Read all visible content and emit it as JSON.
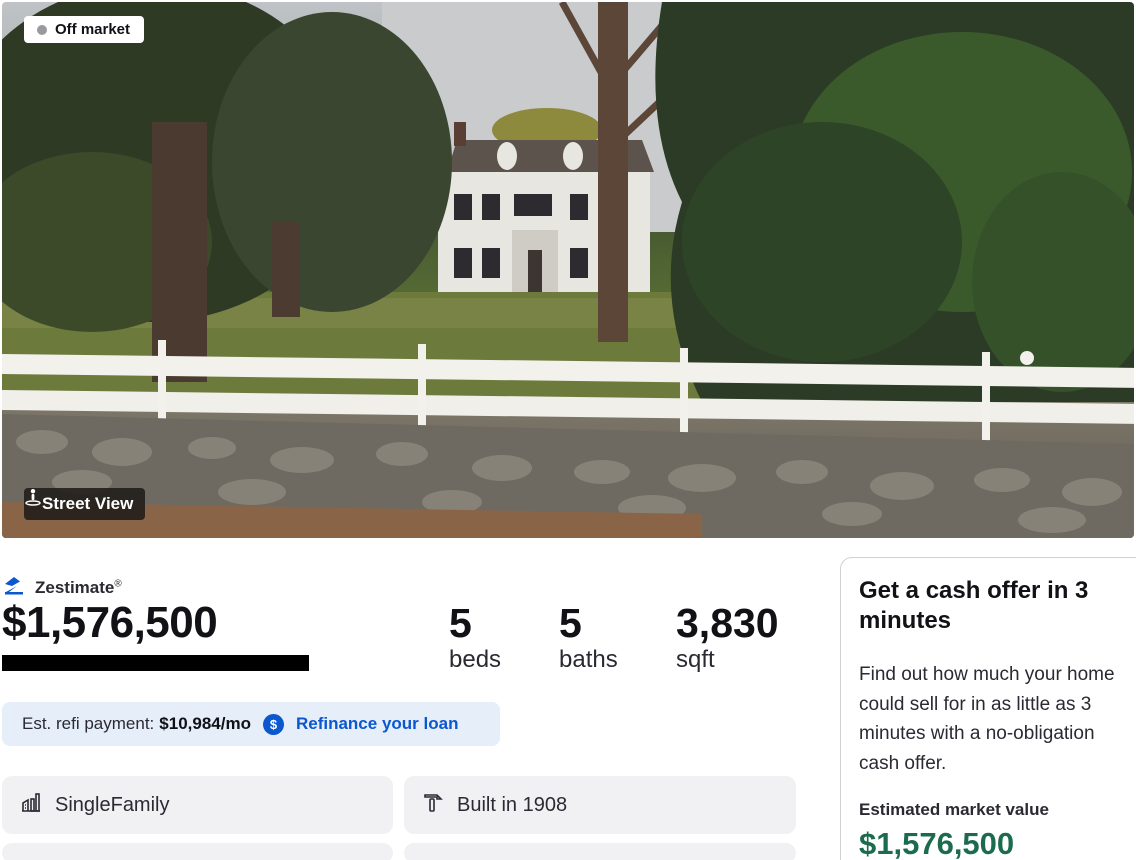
{
  "status": {
    "label": "Off market",
    "dot_color": "#9a9a9e"
  },
  "photo": {
    "street_view_label": "Street View"
  },
  "zestimate": {
    "label": "Zestimate",
    "mark": "®",
    "value": "$1,576,500"
  },
  "facts": [
    {
      "value": "5",
      "unit": "beds"
    },
    {
      "value": "5",
      "unit": "baths"
    },
    {
      "value": "3,830",
      "unit": "sqft"
    }
  ],
  "refi": {
    "label": "Est. refi payment:",
    "amount": "$10,984/mo",
    "link": "Refinance your loan"
  },
  "highlights": [
    {
      "icon": "building-chart-icon",
      "text": "SingleFamily"
    },
    {
      "icon": "hammer-icon",
      "text": "Built in 1908"
    }
  ],
  "cash_offer": {
    "title": "Get a cash offer in 3 minutes",
    "body": "Find out how much your home could sell for in as little as 3 minutes with a no-obligation cash offer.",
    "emv_label": "Estimated market value",
    "emv_value": "$1,576,500"
  },
  "colors": {
    "link_blue": "#0a57d0",
    "refi_bg": "#e5eef9",
    "card_bg": "#f1f1f4",
    "emv_green": "#1c6b4f"
  }
}
